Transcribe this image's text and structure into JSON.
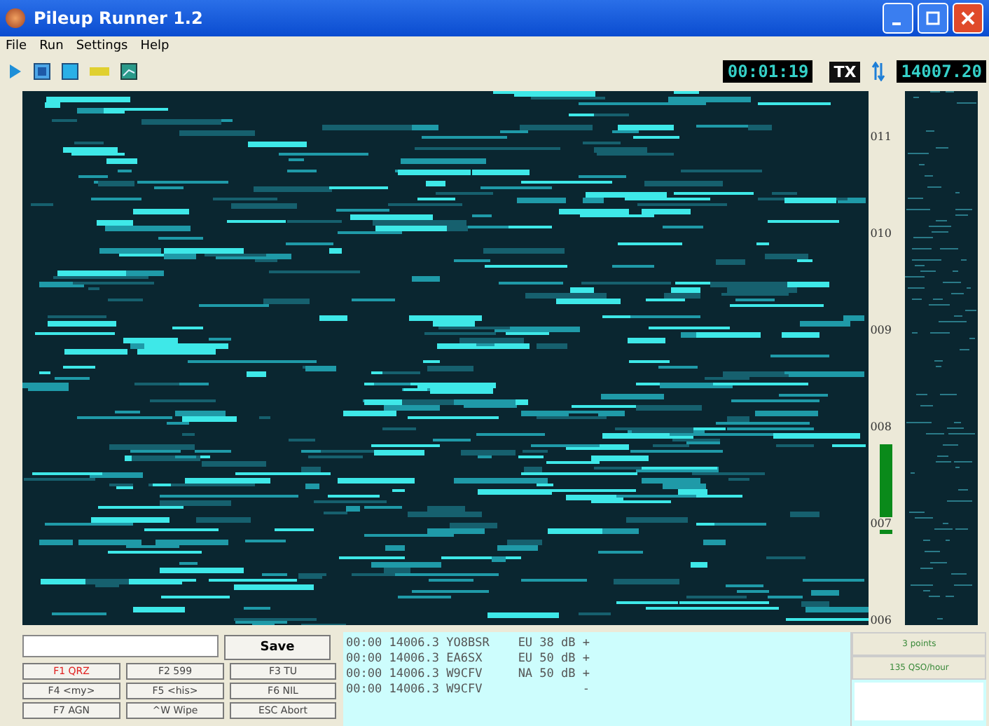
{
  "window": {
    "title": "Pileup Runner 1.2"
  },
  "menu": [
    "File",
    "Run",
    "Settings",
    "Help"
  ],
  "toolbar": {
    "clock": "00:01:19",
    "tx": "TX",
    "frequency": "14007.20"
  },
  "scale": {
    "labels": [
      "011",
      "010",
      "009",
      "008",
      "007",
      "006"
    ]
  },
  "entry": {
    "save": "Save"
  },
  "keys": [
    {
      "label": "F1 QRZ",
      "kind": "alert"
    },
    {
      "label": "F2 599",
      "kind": "normal"
    },
    {
      "label": "F3 TU",
      "kind": "normal"
    },
    {
      "label": "F4 <my>",
      "kind": "normal"
    },
    {
      "label": "F5 <his>",
      "kind": "normal"
    },
    {
      "label": "F6 NIL",
      "kind": "normal"
    },
    {
      "label": "F7 AGN",
      "kind": "normal"
    },
    {
      "label": "^W Wipe",
      "kind": "normal"
    },
    {
      "label": "ESC Abort",
      "kind": "normal"
    }
  ],
  "log": [
    "00:00 14006.3 YO8BSR    EU 38 dB +",
    "00:00 14006.3 EA6SX     EU 50 dB +",
    "00:00 14006.3 W9CFV     NA 50 dB +",
    "00:00 14006.3 W9CFV              -"
  ],
  "stats": [
    "3 points",
    "135 QSO/hour"
  ]
}
